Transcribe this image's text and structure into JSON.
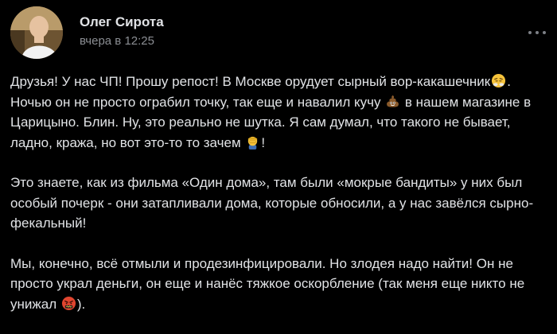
{
  "post": {
    "author": "Олег Сирота",
    "timestamp": "вчера в 12:25",
    "more_icon": "more-dots-icon",
    "paragraphs": [
      {
        "segments": [
          "Друзья! У нас ЧП! Прошу репост! В Москве орудует сырный вор-какашечник",
          ". Ночью он не просто ограбил точку, так еще и навалил кучу ",
          " в нашем магазине в Царицыно. Блин. Ну, это реально не шутка. Я сам думал, что такого не бывает, ладно, кража, но вот это-то то зачем ",
          "!"
        ],
        "emojis": [
          "steam-nose-face-emoji",
          "poop-emoji",
          "facepalm-emoji"
        ]
      },
      {
        "text": "Это знаете, как из фильма «Один дома», там были «мокрые бандиты» у них был особый почерк - они затапливали дома, которые обносили, а у нас завёлся сырно-фекальный!"
      },
      {
        "segments": [
          "Мы, конечно, всё отмыли и продезинфицировали. Но злодея надо найти! Он не просто украл деньги, он еще и нанёс тяжкое оскорбление (так меня еще никто не унижал ",
          ")."
        ],
        "emojis": [
          "cursing-face-emoji"
        ]
      }
    ]
  },
  "colors": {
    "background": "#000000",
    "text": "#e1e3e6",
    "secondary_text": "#8b8e93"
  }
}
